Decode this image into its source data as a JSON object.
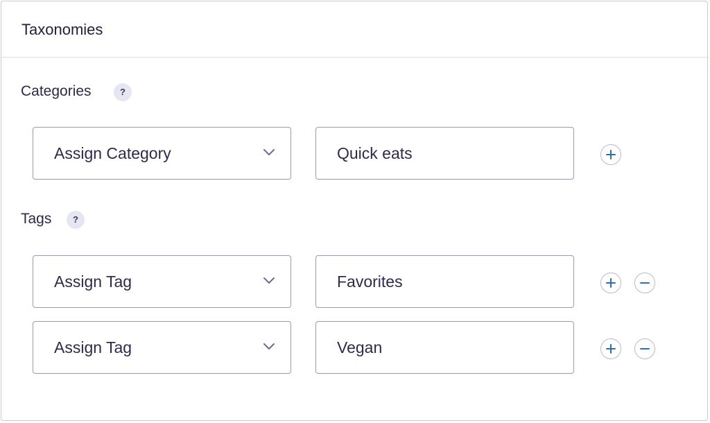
{
  "panel": {
    "title": "Taxonomies"
  },
  "categories": {
    "label": "Categories",
    "help": "?",
    "rows": [
      {
        "select_value": "Assign Category",
        "input_value": "Quick eats"
      }
    ]
  },
  "tags": {
    "label": "Tags",
    "help": "?",
    "rows": [
      {
        "select_value": "Assign Tag",
        "input_value": "Favorites"
      },
      {
        "select_value": "Assign Tag",
        "input_value": "Vegan"
      }
    ]
  },
  "icons": {
    "add": "plus-icon",
    "remove": "minus-icon",
    "dropdown": "chevron-down-icon"
  },
  "colors": {
    "title_text": "#23203f",
    "field_border": "#9a98b6",
    "help_badge_bg": "#e6e6f2",
    "button_icon": "#2c6fa8"
  }
}
